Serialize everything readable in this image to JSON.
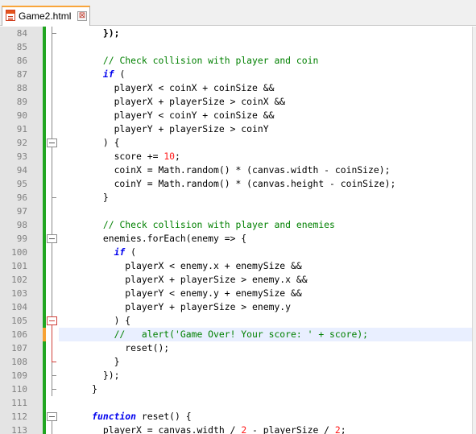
{
  "tab": {
    "title": "Game2.html",
    "close_glyph": "⊠",
    "icon": "html-file-icon"
  },
  "colors": {
    "change_bar": "#21a621",
    "current_line": "#e9efff",
    "comment": "#008000",
    "keyword": "#0000ee",
    "number": "#ff1a1a"
  },
  "current_line": 106,
  "lines": [
    {
      "num": "84",
      "tokens": [
        {
          "t": "        "
        },
        {
          "t": "});",
          "s": "o"
        }
      ]
    },
    {
      "num": "85",
      "tokens": []
    },
    {
      "num": "86",
      "tokens": [
        {
          "t": "        "
        },
        {
          "t": "// Check collision with player and coin",
          "s": "c"
        }
      ]
    },
    {
      "num": "87",
      "tokens": [
        {
          "t": "        "
        },
        {
          "t": "if",
          "s": "k"
        },
        {
          "t": " ("
        }
      ]
    },
    {
      "num": "88",
      "tokens": [
        {
          "t": "          playerX < coinX + coinSize &&"
        }
      ]
    },
    {
      "num": "89",
      "tokens": [
        {
          "t": "          playerX + playerSize > coinX &&"
        }
      ]
    },
    {
      "num": "90",
      "tokens": [
        {
          "t": "          playerY < coinY + coinSize &&"
        }
      ]
    },
    {
      "num": "91",
      "tokens": [
        {
          "t": "          playerY + playerSize > coinY"
        }
      ]
    },
    {
      "num": "92",
      "tokens": [
        {
          "t": "        ) {"
        }
      ]
    },
    {
      "num": "93",
      "tokens": [
        {
          "t": "          score += "
        },
        {
          "t": "10",
          "s": "n"
        },
        {
          "t": ";"
        }
      ]
    },
    {
      "num": "94",
      "tokens": [
        {
          "t": "          coinX = Math.random() * (canvas.width - coinSize);"
        }
      ]
    },
    {
      "num": "95",
      "tokens": [
        {
          "t": "          coinY = Math.random() * (canvas.height - coinSize);"
        }
      ]
    },
    {
      "num": "96",
      "tokens": [
        {
          "t": "        }"
        }
      ]
    },
    {
      "num": "97",
      "tokens": []
    },
    {
      "num": "98",
      "tokens": [
        {
          "t": "        "
        },
        {
          "t": "// Check collision with player and enemies",
          "s": "c"
        }
      ]
    },
    {
      "num": "99",
      "tokens": [
        {
          "t": "        enemies.forEach(enemy => {"
        }
      ]
    },
    {
      "num": "100",
      "tokens": [
        {
          "t": "          "
        },
        {
          "t": "if",
          "s": "k"
        },
        {
          "t": " ("
        }
      ]
    },
    {
      "num": "101",
      "tokens": [
        {
          "t": "            playerX < enemy.x + enemySize &&"
        }
      ]
    },
    {
      "num": "102",
      "tokens": [
        {
          "t": "            playerX + playerSize > enemy.x &&"
        }
      ]
    },
    {
      "num": "103",
      "tokens": [
        {
          "t": "            playerY < enemy.y + enemySize &&"
        }
      ]
    },
    {
      "num": "104",
      "tokens": [
        {
          "t": "            playerY + playerSize > enemy.y"
        }
      ]
    },
    {
      "num": "105",
      "tokens": [
        {
          "t": "          ) {"
        }
      ]
    },
    {
      "num": "106",
      "tokens": [
        {
          "t": "          "
        },
        {
          "t": "//   alert('Game Over! Your score: ' + score);",
          "s": "c"
        }
      ]
    },
    {
      "num": "107",
      "tokens": [
        {
          "t": "            reset();"
        }
      ]
    },
    {
      "num": "108",
      "tokens": [
        {
          "t": "          }"
        }
      ]
    },
    {
      "num": "109",
      "tokens": [
        {
          "t": "        });"
        }
      ]
    },
    {
      "num": "110",
      "tokens": [
        {
          "t": "      }"
        }
      ]
    },
    {
      "num": "111",
      "tokens": []
    },
    {
      "num": "112",
      "tokens": [
        {
          "t": "      "
        },
        {
          "t": "function",
          "s": "k"
        },
        {
          "t": " reset() {"
        }
      ]
    },
    {
      "num": "113",
      "tokens": [
        {
          "t": "        playerX = canvas.width / "
        },
        {
          "t": "2",
          "s": "n"
        },
        {
          "t": " - playerSize / "
        },
        {
          "t": "2",
          "s": "n"
        },
        {
          "t": ";"
        }
      ]
    }
  ]
}
